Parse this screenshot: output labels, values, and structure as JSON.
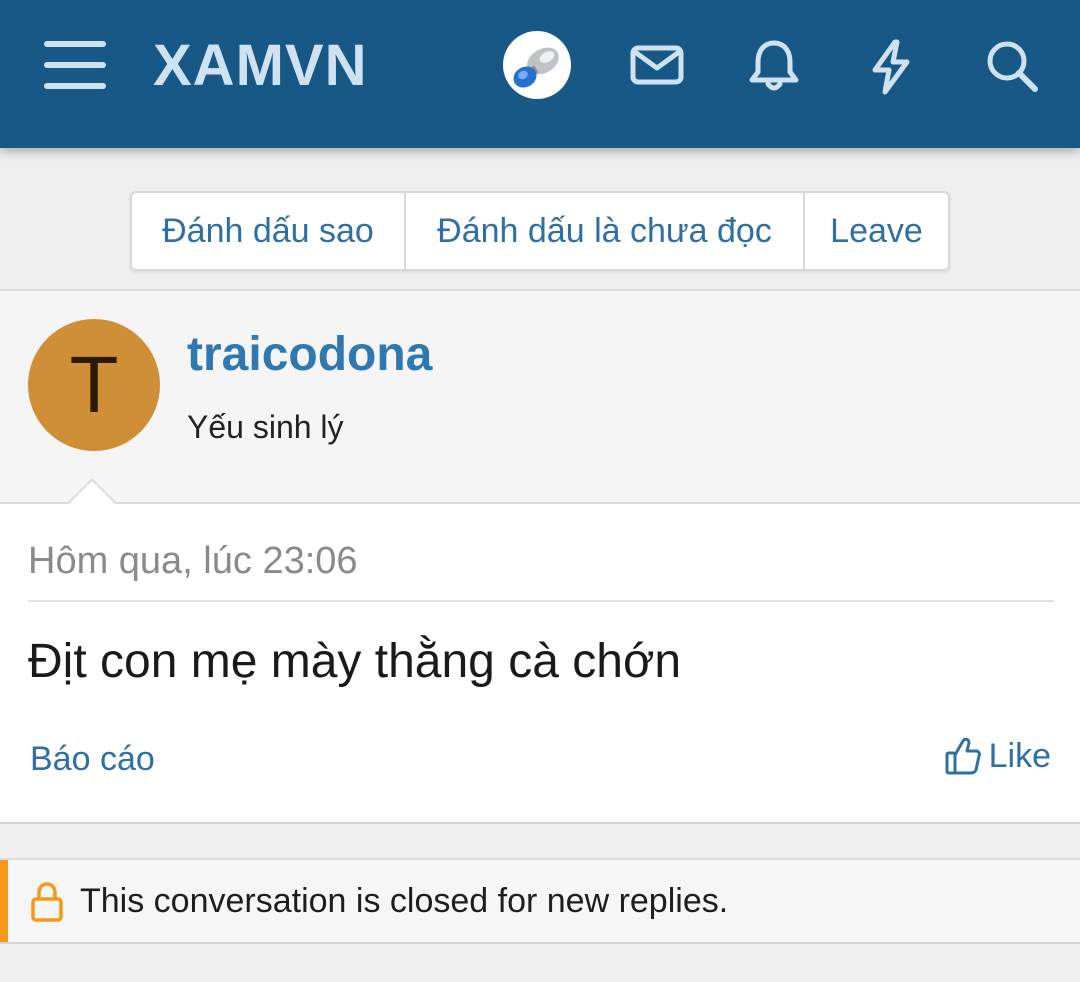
{
  "header": {
    "logo": "XAMVN",
    "colors": {
      "background": "#185886",
      "icon": "#cfe2f1"
    },
    "icons": [
      "menu-icon",
      "user-avatar",
      "mail-icon",
      "bell-icon",
      "bolt-icon",
      "search-icon"
    ]
  },
  "actions": {
    "star": "Đánh dấu sao",
    "mark_unread": "Đánh dấu là chưa đọc",
    "leave": "Leave"
  },
  "message": {
    "avatar_letter": "T",
    "avatar_color": "#cf8f37",
    "username": "traicodona",
    "user_title": "Yếu sinh lý",
    "time": "Hôm qua, lúc 23:06",
    "text": "Địt con mẹ mày thằng cà chớn",
    "report": "Báo cáo",
    "like": "Like"
  },
  "notice": {
    "text": "This conversation is closed for new replies.",
    "accent": "#f39a1c"
  }
}
